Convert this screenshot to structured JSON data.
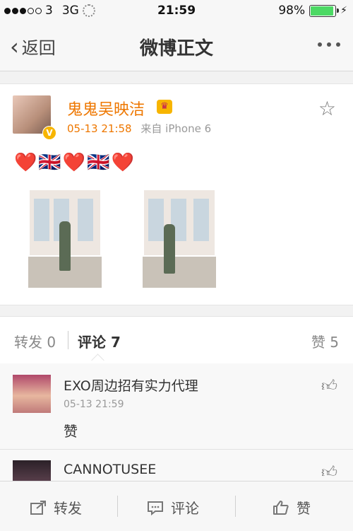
{
  "status_bar": {
    "carrier": "3",
    "network": "3G",
    "time": "21:59",
    "battery": "98%",
    "battery_level": 0.98
  },
  "nav": {
    "back_label": "返回",
    "title": "微博正文"
  },
  "post": {
    "author": "鬼鬼吴映洁",
    "time": "05-13 21:58",
    "source_prefix": "来自",
    "source": "iPhone 6",
    "content": "❤️🇬🇧❤️🇬🇧❤️"
  },
  "tabs": {
    "repost": "转发 0",
    "comment": "评论 7",
    "like": "赞 5"
  },
  "comments": [
    {
      "name": "EXO周边招有实力代理",
      "time": "05-13 21:59",
      "text": "赞"
    },
    {
      "name": "CANNOTUSEE"
    }
  ],
  "toolbar": {
    "repost": "转发",
    "comment": "评论",
    "like": "赞"
  },
  "colors": {
    "accent": "#ee7700",
    "verified": "#f7b500",
    "battery": "#4cd964"
  }
}
